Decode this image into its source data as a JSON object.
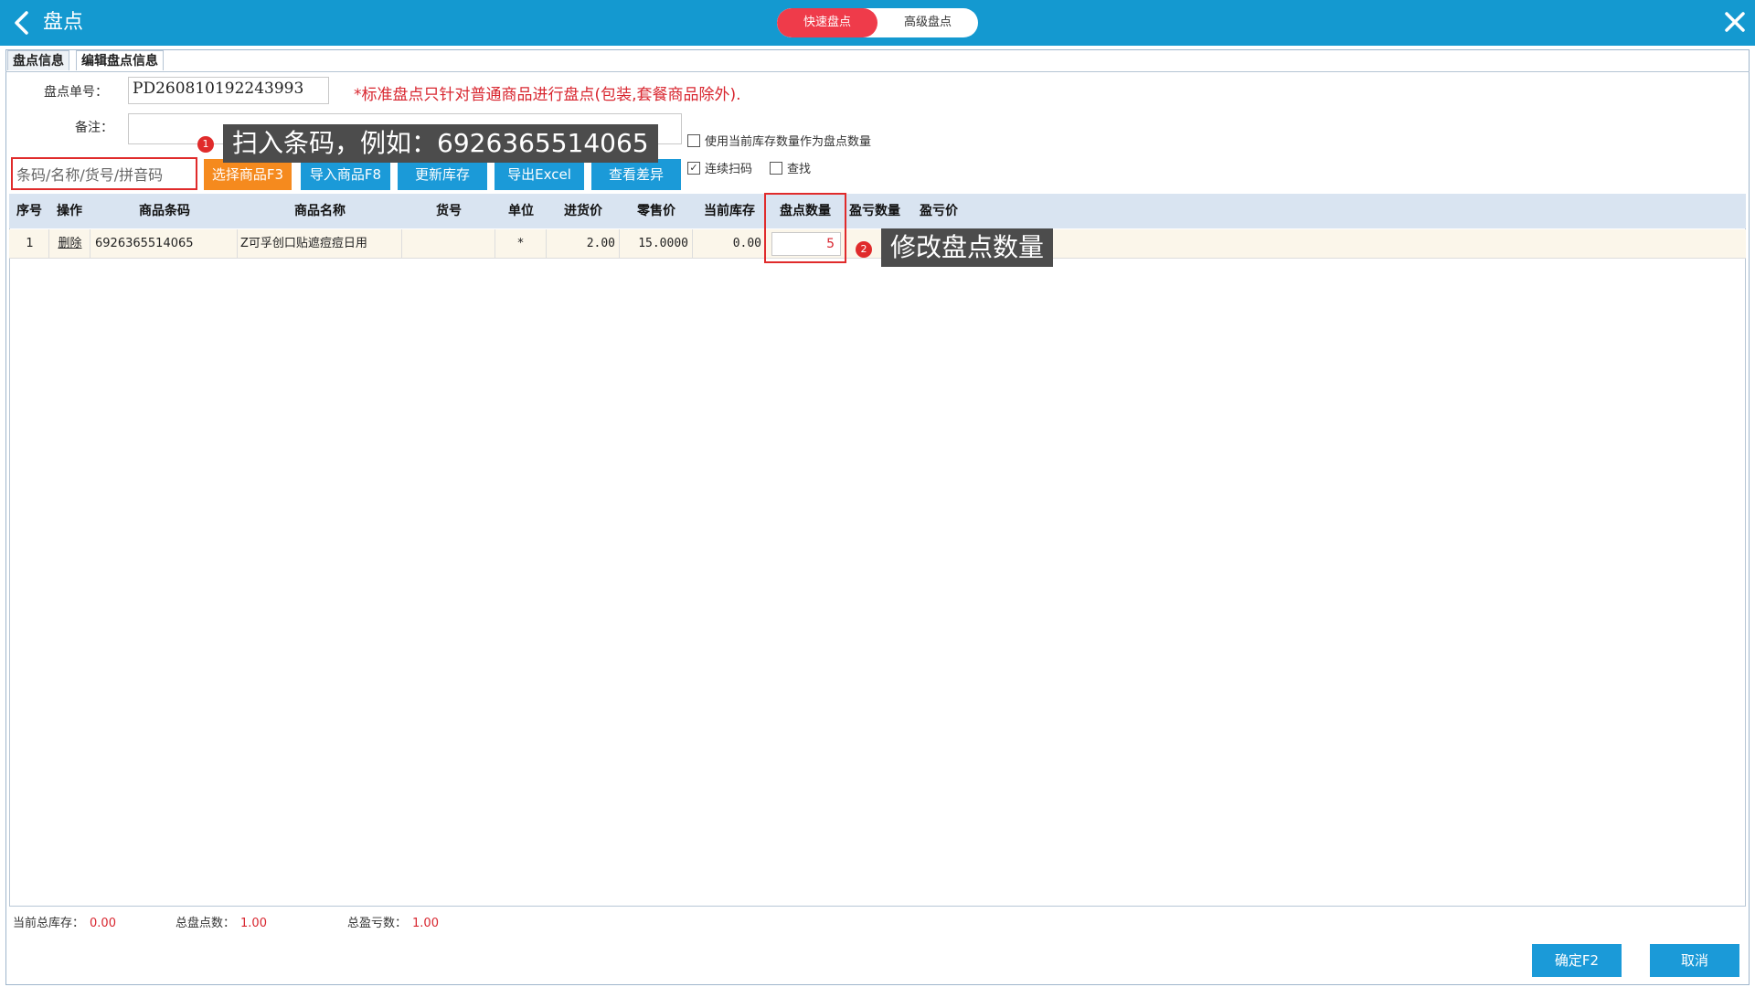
{
  "header": {
    "title": "盘点",
    "modes": [
      "快速盘点",
      "高级盘点"
    ]
  },
  "tabs": [
    "盘点信息",
    "编辑盘点信息"
  ],
  "form": {
    "order_label": "盘点单号：",
    "order_value": "PD260810192243993",
    "note_label": "备注：",
    "note_value": "",
    "notice": "*标准盘点只针对普通商品进行盘点(包装,套餐商品除外)."
  },
  "options": {
    "use_stock": {
      "label": "使用当前库存数量作为盘点数量",
      "checked": false
    },
    "continuous_scan": {
      "label": "连续扫码",
      "checked": true
    },
    "find": {
      "label": "查找",
      "checked": false
    }
  },
  "search": {
    "placeholder": "条码/名称/货号/拼音码"
  },
  "buttons": {
    "select": "选择商品F3",
    "import": "导入商品F8",
    "update": "更新库存",
    "export": "导出Excel",
    "diff": "查看差异"
  },
  "tooltips": {
    "scan": "扫入条码，例如：6926365514065",
    "scan_badge": "1",
    "qty": "修改盘点数量",
    "qty_badge": "2"
  },
  "table": {
    "columns": [
      "序号",
      "操作",
      "商品条码",
      "商品名称",
      "货号",
      "单位",
      "进货价",
      "零售价",
      "当前库存",
      "盘点数量",
      "盈亏数量",
      "盈亏价"
    ],
    "rows": [
      [
        "1",
        "删除",
        "6926365514065",
        "Z可孚创口贴遮痘痘日用",
        "",
        "*",
        "2.00",
        "15.0000",
        "0.00",
        "5",
        "",
        ""
      ]
    ]
  },
  "summary": {
    "current_stock_label": "当前总库存：",
    "current_stock_value": "0.00",
    "total_count_label": "总盘点数：",
    "total_count_value": "1.00",
    "total_diff_label": "总盈亏数：",
    "total_diff_value": "1.00"
  },
  "footer": {
    "confirm": "确定F2",
    "cancel": "取消"
  },
  "colors": {
    "header": "#1499d0",
    "accent_red": "#e02b2b",
    "orange": "#f58a1e",
    "button_blue": "#1b9ad8"
  }
}
